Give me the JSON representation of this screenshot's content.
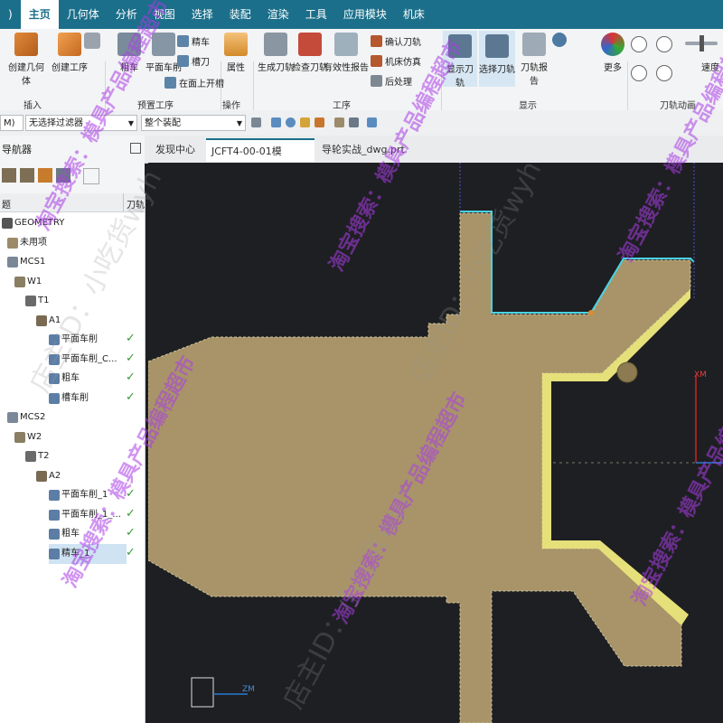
{
  "menu": {
    "items": [
      "主页",
      "几何体",
      "分析",
      "视图",
      "选择",
      "装配",
      "渲染",
      "工具",
      "应用模块",
      "机床"
    ],
    "active_index": 0
  },
  "ribbon": {
    "insert": {
      "create_geometry": "创建几何体",
      "create_operation": "创建工序"
    },
    "preview": {
      "rough": "粗车",
      "face_turn": "平面车削",
      "finish": "精车",
      "groove_tool": "槽刀",
      "groove_on_face": "在面上开槽"
    },
    "ops": {
      "property": "属性"
    },
    "process": {
      "gen_path": "生成刀轨",
      "check_tool": "检查刀轨",
      "validity": "有效性报告",
      "confirm_path": "确认刀轨",
      "machine_sim": "机床仿真",
      "post": "后处理"
    },
    "display": {
      "show_path": "显示刀轨",
      "select_path": "选择刀轨",
      "path_report": "刀轨报告",
      "more": "更多"
    },
    "anim": {
      "speed": "速度"
    },
    "groups": {
      "insert": "插入",
      "preview": "预置工序",
      "ops": "操作",
      "process": "工序",
      "display": "显示",
      "anim": "刀轨动画"
    }
  },
  "toolbar": {
    "filter_left": "M)",
    "filter": "无选择过滤器",
    "assembly": "整个装配"
  },
  "navigator": {
    "title": "导航器",
    "col_name": "题",
    "col_tool": "刀轨",
    "rows": [
      {
        "label": "GEOMETRY",
        "check": false
      },
      {
        "label": "未用项",
        "check": false
      },
      {
        "label": "MCS1",
        "check": false
      },
      {
        "label": "W1",
        "check": false
      },
      {
        "label": "T1",
        "check": false
      },
      {
        "label": "A1",
        "check": false
      },
      {
        "label": "平面车削",
        "check": true
      },
      {
        "label": "平面车削_C...",
        "check": true
      },
      {
        "label": "粗车",
        "check": true
      },
      {
        "label": "槽车削",
        "check": true
      },
      {
        "label": "MCS2",
        "check": false
      },
      {
        "label": "W2",
        "check": false
      },
      {
        "label": "T2",
        "check": false
      },
      {
        "label": "A2",
        "check": false
      },
      {
        "label": "平面车削_1",
        "check": true
      },
      {
        "label": "平面车削_1_...",
        "check": true
      },
      {
        "label": "粗车",
        "check": true
      },
      {
        "label": "精车_1",
        "check": true
      }
    ]
  },
  "tabs": [
    {
      "label": "发现中心"
    },
    {
      "label": "JCFT4-00-01模芯.prt"
    },
    {
      "label": "导轮实战_dwg.prt"
    }
  ],
  "viewport": {
    "axis_xm": "XM",
    "axis_zm": "ZM",
    "colors": {
      "part": "#a89468",
      "finish": "#e6e07a",
      "toolpath": "#49d3e3",
      "bg": "#1e1f22"
    }
  },
  "watermarks": [
    "淘宝搜索：模具产品编程超市",
    "店主ID：小吃货wyh"
  ]
}
